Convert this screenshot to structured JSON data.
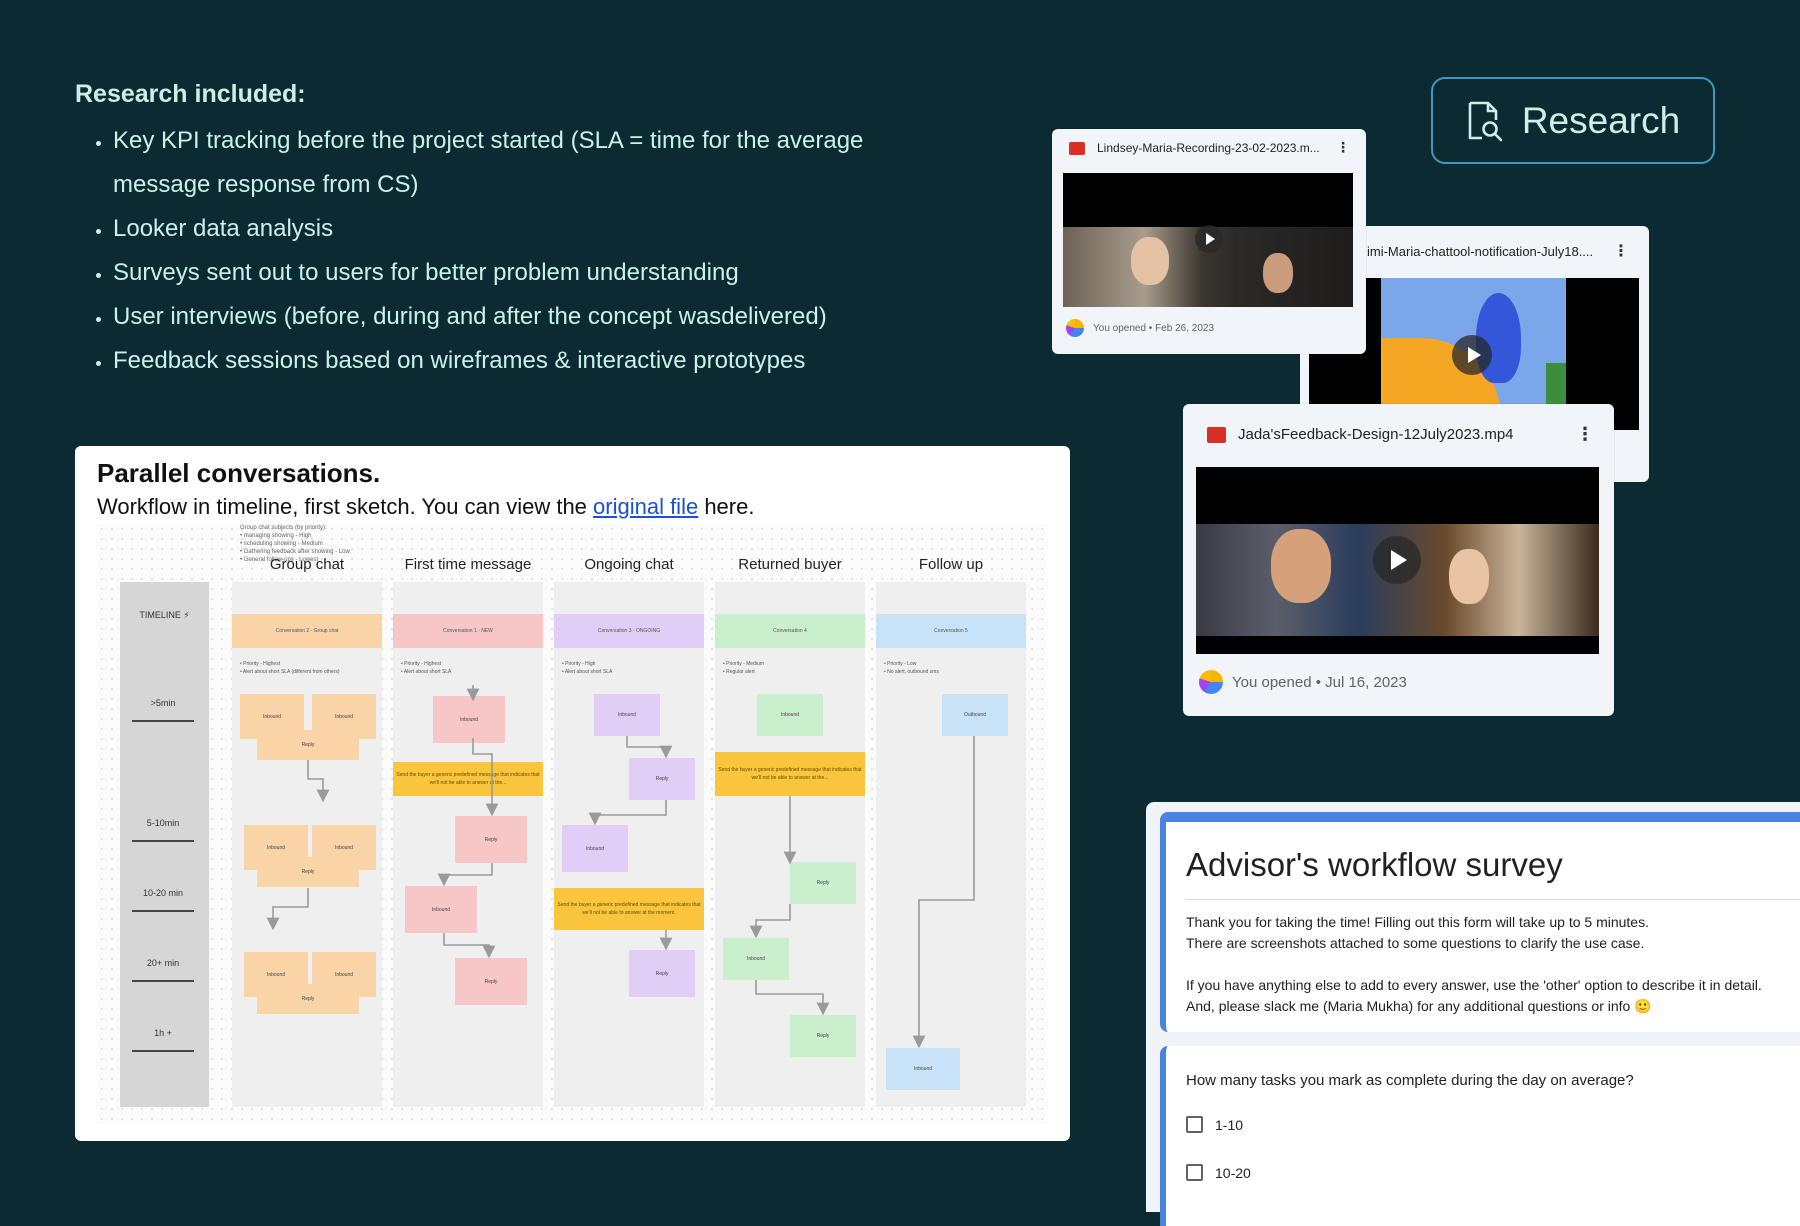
{
  "research": {
    "heading": "Research included:",
    "items": [
      "Key KPI tracking before the project started (SLA = time for the average message response from CS)",
      "Looker data analysis",
      "Surveys sent out to users for better problem understanding",
      "User interviews (before, during and after the concept wasdelivered)",
      "Feedback sessions based on wireframes & interactive prototypes"
    ]
  },
  "research_button": {
    "label": "Research",
    "icon": "document-search-icon"
  },
  "diagram": {
    "title": "Parallel conversations.",
    "subtitle_before": "Workflow in timeline, first sketch. You can view the ",
    "link_text": "original file",
    "subtitle_after": " here.",
    "group_note": [
      "Group chat subjects (by priority):",
      "• managing showing - High",
      "• scheduling showing - Medium",
      "• Gathering feedback after showing - Low",
      "• General follow-ups - Lowest"
    ],
    "timeline_title": "TIMELINE ⚡",
    "timeline_marks": [
      ">5min",
      "5-10min",
      "10-20 min",
      "20+ min",
      "1h +"
    ],
    "lanes": [
      {
        "title": "Group chat",
        "header": "Conversation 2 - Group chat",
        "color": "#f9d4a6",
        "notes": [
          "• Priority - Highest",
          "• Alert about short SLA (different from others)"
        ]
      },
      {
        "title": "First time message",
        "header": "Conversation 1 - NEW",
        "color": "#f7c6c6",
        "notes": [
          "• Priority - Highest",
          "• Alert about short SLA"
        ]
      },
      {
        "title": "Ongoing chat",
        "header": "Conversation 3 - ONGOING",
        "color": "#e1cef7",
        "notes": [
          "• Priority - High",
          "• Alert about short SLA"
        ]
      },
      {
        "title": "Returned buyer",
        "header": "Conversation 4",
        "color": "#c9efcc",
        "notes": [
          "• Priority - Medium",
          "• Regular alert"
        ]
      },
      {
        "title": "Follow up",
        "header": "Conversation 5",
        "color": "#c8e3f8",
        "notes": [
          "• Priority - Low",
          "• No alert, outbound sms"
        ]
      }
    ],
    "labels": {
      "inbound": "Inbound",
      "reply": "Reply",
      "outbound": "Outbound",
      "predefined": "Send the buyer a generic predefined message that indicates that we'll not be able to answer at the moment."
    },
    "predefined_short": "Send the buyer a generic predefined message that indicates that we'll not be able to answer at the..."
  },
  "videos": [
    {
      "filename": "Lindsey-Maria-Recording-23-02-2023.m...",
      "meta": "You opened • Feb 26, 2023"
    },
    {
      "filename": "imi-Maria-chattool-notification-July18...."
    },
    {
      "filename": "Jada'sFeedback-Design-12July2023.mp4",
      "meta": "You opened • Jul 16, 2023"
    }
  ],
  "survey": {
    "title": "Advisor's workflow survey",
    "description": [
      "Thank you for taking the time! Filling out this form will take up to 5 minutes.",
      "There are screenshots attached to some questions to clarify the use case.",
      "",
      "If you have anything else to add to every answer, use the 'other' option to describe it in detail.",
      "And, please slack me (Maria Mukha) for any additional questions or info 🙂"
    ],
    "question": "How many tasks you mark as complete during the day on average?",
    "options": [
      "1-10",
      "10-20"
    ]
  },
  "colors": {
    "background": "#0b2a31",
    "accent": "#3e98c0",
    "survey_accent": "#4a84df"
  }
}
